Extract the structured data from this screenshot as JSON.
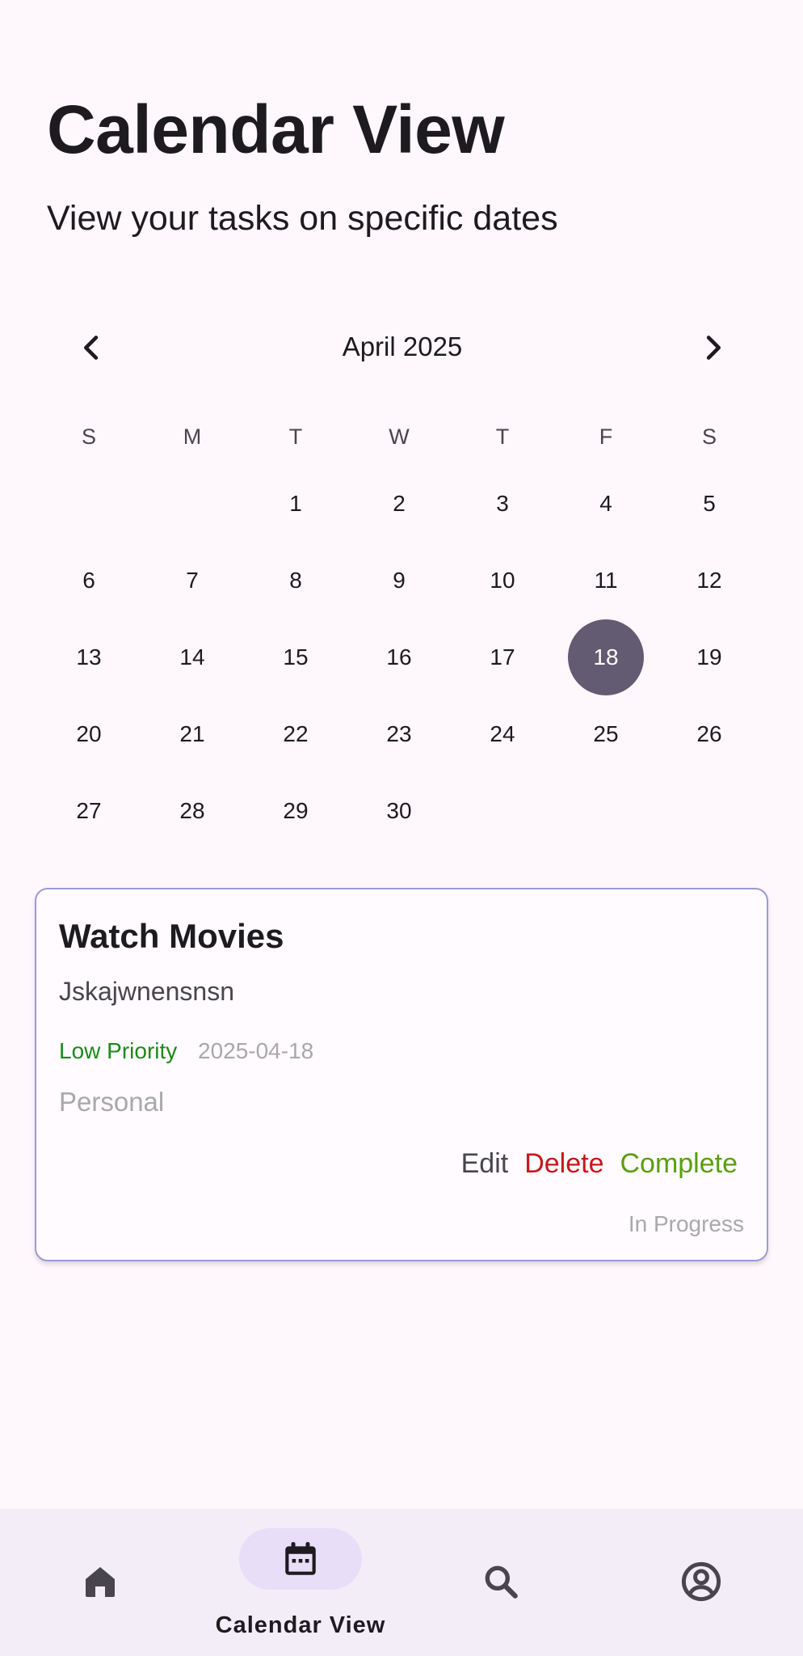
{
  "header": {
    "title": "Calendar View",
    "subtitle": "View your tasks on specific dates"
  },
  "calendar": {
    "month_label": "April 2025",
    "prev_icon": "chevron-left-icon",
    "next_icon": "chevron-right-icon",
    "weekdays": [
      "S",
      "M",
      "T",
      "W",
      "T",
      "F",
      "S"
    ],
    "weeks": [
      [
        "",
        "",
        "1",
        "2",
        "3",
        "4",
        "5"
      ],
      [
        "6",
        "7",
        "8",
        "9",
        "10",
        "11",
        "12"
      ],
      [
        "13",
        "14",
        "15",
        "16",
        "17",
        "18",
        "19"
      ],
      [
        "20",
        "21",
        "22",
        "23",
        "24",
        "25",
        "26"
      ],
      [
        "27",
        "28",
        "29",
        "30",
        "",
        "",
        ""
      ]
    ],
    "selected_day": "18",
    "selected_color": "#625B71"
  },
  "task": {
    "title": "Watch Movies",
    "description": "Jskajwnensnsn",
    "priority": "Low Priority",
    "date": "2025-04-18",
    "category": "Personal",
    "actions": {
      "edit": "Edit",
      "delete": "Delete",
      "complete": "Complete"
    },
    "status": "In Progress",
    "colors": {
      "priority": "#1B8A1B",
      "delete": "#C6171C",
      "complete": "#5A9E10",
      "border": "#9B9BD6"
    }
  },
  "bottom_nav": {
    "items": [
      {
        "icon": "home-icon",
        "label": ""
      },
      {
        "icon": "calendar-icon",
        "label": "Calendar View",
        "active": true
      },
      {
        "icon": "search-icon",
        "label": ""
      },
      {
        "icon": "account-icon",
        "label": ""
      }
    ],
    "active_label": "Calendar View",
    "active_pill_color": "#E8DEF8"
  }
}
